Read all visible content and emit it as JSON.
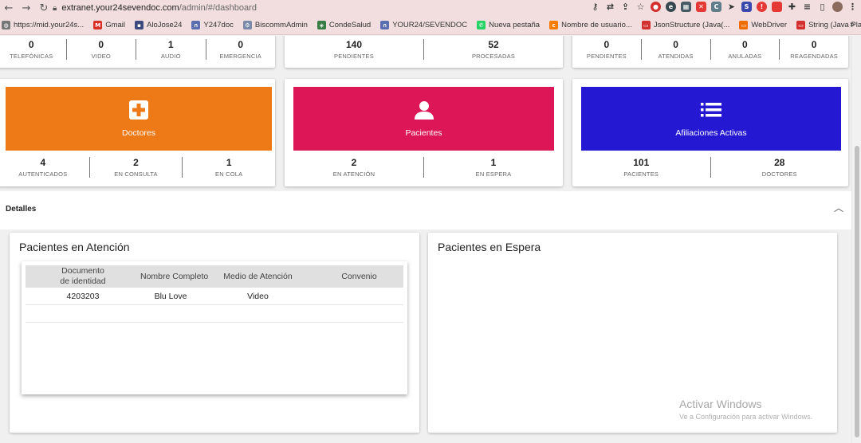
{
  "browser": {
    "url_host": "extranet.your24sevendoc.com",
    "url_path": "/admin/#/dashboard",
    "bookmarks": [
      {
        "label": "https://mid.your24s...",
        "icon": "globe-icon",
        "color": "#777777"
      },
      {
        "label": "Gmail",
        "icon": "gmail-icon",
        "color": "#d93025"
      },
      {
        "label": "AloJose24",
        "icon": "bookmark-icon",
        "color": "#3c4a7d"
      },
      {
        "label": "Y247doc",
        "icon": "arc-icon",
        "color": "#5b6fb0"
      },
      {
        "label": "BiscommAdmin",
        "icon": "gear-icon",
        "color": "#7a8aa8"
      },
      {
        "label": "CondeSalud",
        "icon": "shield-icon",
        "color": "#3a7d44"
      },
      {
        "label": "YOUR24/SEVENDOC",
        "icon": "arc-icon",
        "color": "#5b6fb0"
      },
      {
        "label": "Nueva pestaña",
        "icon": "whatsapp-icon",
        "color": "#25d366"
      },
      {
        "label": "Nombre de usuario...",
        "icon": "cp-icon",
        "color": "#f57c00"
      },
      {
        "label": "JsonStructure (Java(...",
        "icon": "oracle-icon",
        "color": "#d32f2f"
      },
      {
        "label": "WebDriver",
        "icon": "webdriver-icon",
        "color": "#ef6c00"
      },
      {
        "label": "String (Java Platfor...",
        "icon": "oracle-icon",
        "color": "#d32f2f"
      }
    ],
    "more": "»"
  },
  "top_row": {
    "card1": [
      {
        "value": "0",
        "label": "TELEFÓNICAS"
      },
      {
        "value": "0",
        "label": "VIDEO"
      },
      {
        "value": "1",
        "label": "AUDIO"
      },
      {
        "value": "0",
        "label": "EMERGENCIA"
      }
    ],
    "card2": [
      {
        "value": "140",
        "label": "PENDIENTES"
      },
      {
        "value": "52",
        "label": "PROCESADAS"
      }
    ],
    "card3": [
      {
        "value": "0",
        "label": "PENDIENTES"
      },
      {
        "value": "0",
        "label": "ATENDIDAS"
      },
      {
        "value": "0",
        "label": "ANULADAS"
      },
      {
        "value": "0",
        "label": "REAGENDADAS"
      }
    ]
  },
  "tiles": {
    "doctores": {
      "title": "Doctores",
      "color": "#ee7a17",
      "icon": "medical-cross-icon",
      "stats": [
        {
          "value": "4",
          "label": "AUTENTICADOS"
        },
        {
          "value": "2",
          "label": "EN CONSULTA"
        },
        {
          "value": "1",
          "label": "EN COLA"
        }
      ]
    },
    "pacientes": {
      "title": "Pacientes",
      "color": "#dc1657",
      "icon": "person-icon",
      "stats": [
        {
          "value": "2",
          "label": "EN ATENCIÓN"
        },
        {
          "value": "1",
          "label": "EN ESPERA"
        }
      ]
    },
    "afiliaciones": {
      "title": "Afiliaciones Activas",
      "color": "#2418d2",
      "icon": "list-icon",
      "stats": [
        {
          "value": "101",
          "label": "PACIENTES"
        },
        {
          "value": "28",
          "label": "DOCTORES"
        }
      ]
    }
  },
  "details": {
    "label": "Detalles",
    "chevron": "^"
  },
  "panels": {
    "atencion": {
      "title": "Pacientes en Atención",
      "columns": [
        "Documento de identidad",
        "Nombre Completo",
        "Medio de Atención",
        "Convenio"
      ],
      "rows": [
        {
          "documento": "4203203",
          "nombre": "Blu Love",
          "medio": "Video",
          "convenio": ""
        }
      ]
    },
    "espera": {
      "title": "Pacientes en Espera"
    }
  },
  "watermark": {
    "line1": "Activar Windows",
    "line2": "Ve a Configuración para activar Windows."
  }
}
